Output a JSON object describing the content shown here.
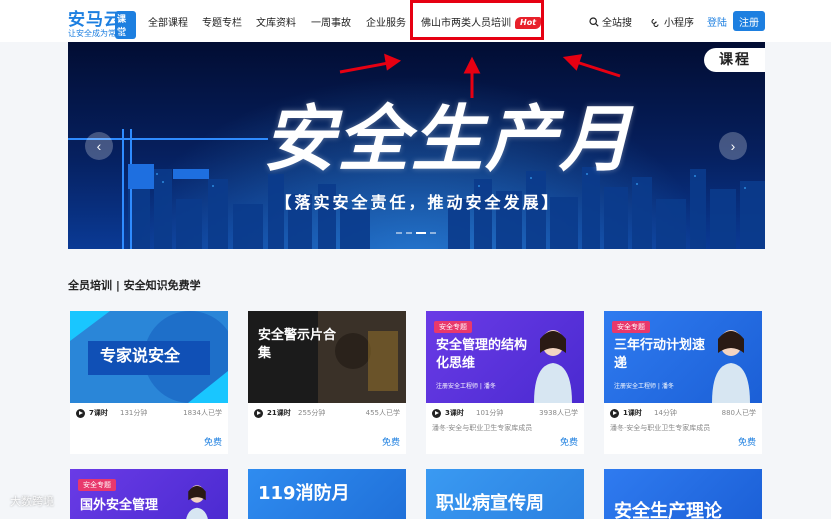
{
  "brand": {
    "name": "安马云",
    "badge": "课堂",
    "slogan": "让安全成为常识"
  },
  "nav": {
    "items": [
      "全部课程",
      "专题专栏",
      "文库资料",
      "一周事故",
      "企业服务",
      "佛山市两类人员培训"
    ],
    "hot_badge": "Hot",
    "search_label": "全站搜",
    "mini_program_label": "小程序",
    "login_label": "登陆",
    "register_label": "注册"
  },
  "banner": {
    "title": "安全生产月",
    "subtitle": "【落实安全责任，推动安全发展】",
    "side_tab": "课程",
    "prev_icon": "chevron-left-icon",
    "next_icon": "chevron-right-icon"
  },
  "section": {
    "title": "全员培训 | 安全知识免费学"
  },
  "courses": [
    {
      "thumb_title": "专家说安全",
      "lessons": "7课时",
      "minutes": "131分钟",
      "learners": "1834人已学",
      "provider": "",
      "price": "免费"
    },
    {
      "thumb_title": "安全警示片合集",
      "lessons": "21课时",
      "minutes": "255分钟",
      "learners": "455人已学",
      "provider": "",
      "price": "免费"
    },
    {
      "thumb_tag": "安全专题",
      "thumb_title": "安全管理的结构化思维",
      "thumb_sub": "注册安全工程师 | 潘冬",
      "lessons": "3课时",
      "minutes": "101分钟",
      "learners": "3938人已学",
      "provider": "潘冬·安全与职业卫生专家库成员",
      "price": "免费"
    },
    {
      "thumb_tag": "安全专题",
      "thumb_title": "三年行动计划速递",
      "thumb_sub": "注册安全工程师 | 潘冬",
      "lessons": "1课时",
      "minutes": "14分钟",
      "learners": "880人已学",
      "provider": "潘冬·安全与职业卫生专家库成员",
      "price": "免费"
    }
  ],
  "courses_row2": [
    {
      "thumb_tag": "安全专题",
      "thumb_title": "国外安全管理"
    },
    {
      "thumb_title": "119消防月"
    },
    {
      "thumb_title": "职业病宣传周"
    },
    {
      "thumb_title": "安全生产理论"
    }
  ],
  "watermark": "大数跨境"
}
